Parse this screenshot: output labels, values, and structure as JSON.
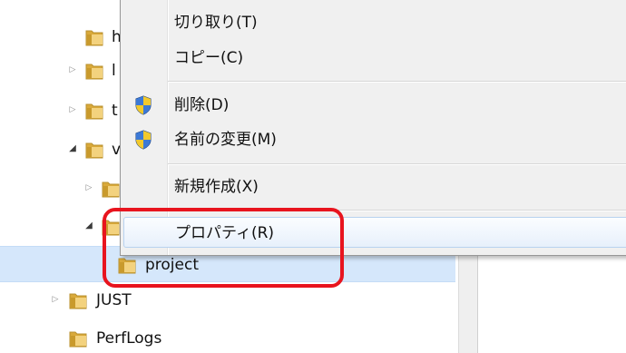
{
  "tree": {
    "items": [
      {
        "label": "h",
        "indent": 1,
        "expander": "none"
      },
      {
        "label": "l",
        "indent": 1,
        "expander": "collapsed"
      },
      {
        "label": "t",
        "indent": 1,
        "expander": "collapsed"
      },
      {
        "label": "v",
        "indent": 1,
        "expander": "expanded"
      },
      {
        "label": "",
        "indent": 2,
        "expander": "collapsed"
      },
      {
        "label": "",
        "indent": 2,
        "expander": "expanded"
      },
      {
        "label": "project",
        "indent": 3,
        "expander": "none",
        "selected": true
      },
      {
        "label": "JUST",
        "indent": 0,
        "expander": "collapsed"
      },
      {
        "label": "PerfLogs",
        "indent": 0,
        "expander": "none"
      }
    ]
  },
  "context_menu": {
    "items": [
      {
        "label": "切り取り(T)",
        "icon": ""
      },
      {
        "label": "コピー(C)",
        "icon": ""
      },
      {
        "label": "削除(D)",
        "icon": "uac-shield-icon"
      },
      {
        "label": "名前の変更(M)",
        "icon": "uac-shield-icon"
      },
      {
        "label": "新規作成(X)",
        "icon": ""
      },
      {
        "label": "プロパティ(R)",
        "icon": "",
        "hovered": true
      }
    ]
  },
  "colors": {
    "highlight": "#e8141e",
    "selection": "#d5e7fb",
    "folder": "#e9c15a",
    "menu_bg": "#f0f0f0"
  }
}
